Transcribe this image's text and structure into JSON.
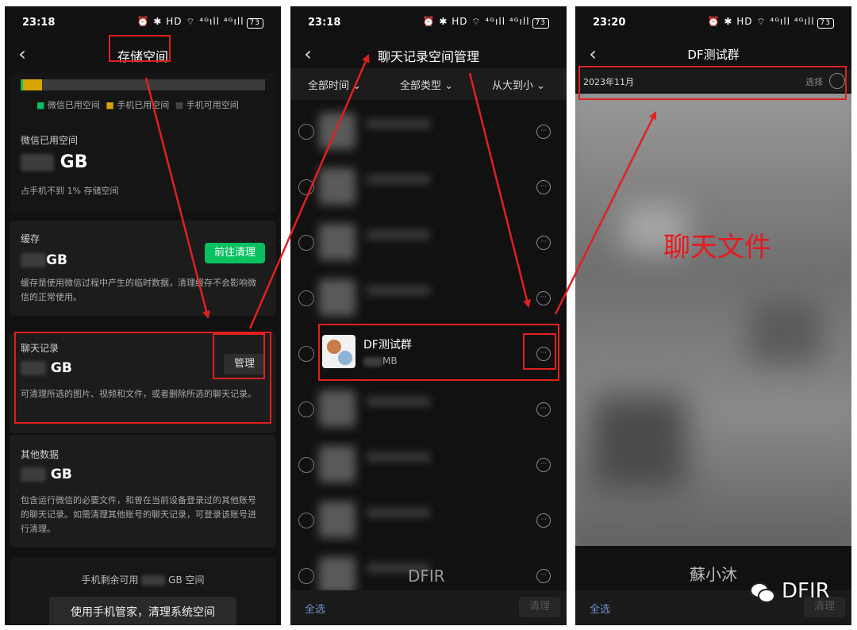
{
  "left": {
    "time": "23:18",
    "status_icons": "⏰ ✱ HD ⌔ ⁴ᴳıll ⁴ᴳıll",
    "battery": "73",
    "title": "存储空间",
    "legend": [
      "微信已用空间",
      "手机已用空间",
      "手机可用空间"
    ],
    "wechat_used_label": "微信已用空间",
    "wechat_used_unit": "GB",
    "wechat_used_note": "占手机不到 1% 存储空间",
    "cache_label": "缓存",
    "cache_unit": "GB",
    "cache_button": "前往清理",
    "cache_desc": "缓存是使用微信过程中产生的临时数据，清理缓存不会影响微信的正常使用。",
    "chat_label": "聊天记录",
    "chat_unit": "GB",
    "chat_button": "管理",
    "chat_desc": "可清理所选的图片、视频和文件，或者删除所选的聊天记录。",
    "other_label": "其他数据",
    "other_unit": "GB",
    "other_desc": "包含运行微信的必要文件，和曾在当前设备登录过的其他账号的聊天记录。如需清理其他账号的聊天记录，可登录该账号进行清理。",
    "remaining_prefix": "手机剩余可用",
    "remaining_suffix": "GB 空间",
    "phone_manager_button": "使用手机管家，清理系统空间",
    "colors": {
      "wechat": "#07c160",
      "phone_used": "#d9a300",
      "red_annotation": "#e02020"
    }
  },
  "middle": {
    "time": "23:18",
    "status_icons": "⏰ ✱ HD ⌔ ⁴ᴳıll ⁴ᴳıll",
    "battery": "73",
    "title": "聊天记录空间管理",
    "filters": [
      "全部时间",
      "全部类型",
      "从大到小"
    ],
    "group_name": "DF测试群",
    "group_size_unit": "MB",
    "watermark": "DFIR",
    "select_all": "全选",
    "clean_button": "清理"
  },
  "right": {
    "time": "23:20",
    "status_icons": "⏰ ✱ HD ⌔ ⁴ᴳıll ⁴ᴳıll",
    "battery": "73",
    "title": "DF测试群",
    "month": "2023年11月",
    "select": "选择",
    "annotation": "聊天文件",
    "watermark": "蘇小沐",
    "select_all": "全选",
    "clean_button": "清理",
    "brand": "DFIR"
  }
}
